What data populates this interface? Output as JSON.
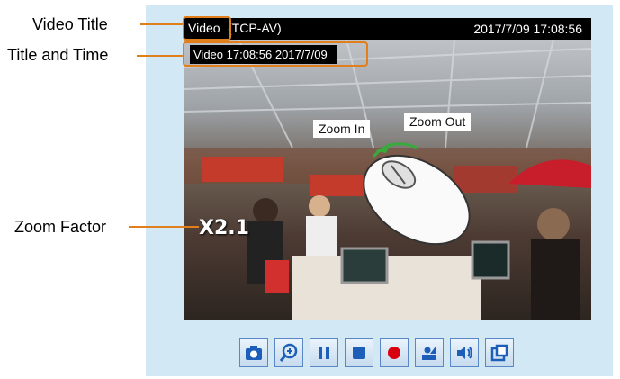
{
  "viewer": {
    "video_title": "Video",
    "stream": "(TCP-AV)",
    "datetime": "2017/7/09  17:08:56",
    "overlay_title_time": "Video 17:08:56  2017/7/09",
    "zoom_factor": "X2.1"
  },
  "hints": {
    "zoom_in": "Zoom In",
    "zoom_out": "Zoom Out"
  },
  "annotations": {
    "video_title": "Video Title",
    "title_and_time": "Title and Time",
    "zoom_factor": "Zoom Factor"
  },
  "toolbar": {
    "buttons": [
      {
        "icon": "camera-icon"
      },
      {
        "icon": "zoom-in-icon"
      },
      {
        "icon": "pause-icon"
      },
      {
        "icon": "stop-icon"
      },
      {
        "icon": "record-icon"
      },
      {
        "icon": "video-adjust-icon"
      },
      {
        "icon": "speaker-icon"
      },
      {
        "icon": "fullscreen-icon"
      }
    ]
  },
  "colors": {
    "accent_orange": "#e07f1c",
    "panel_bg": "#d2e9f5",
    "button_blue": "#1d5fb8",
    "record_red": "#d8000f"
  }
}
